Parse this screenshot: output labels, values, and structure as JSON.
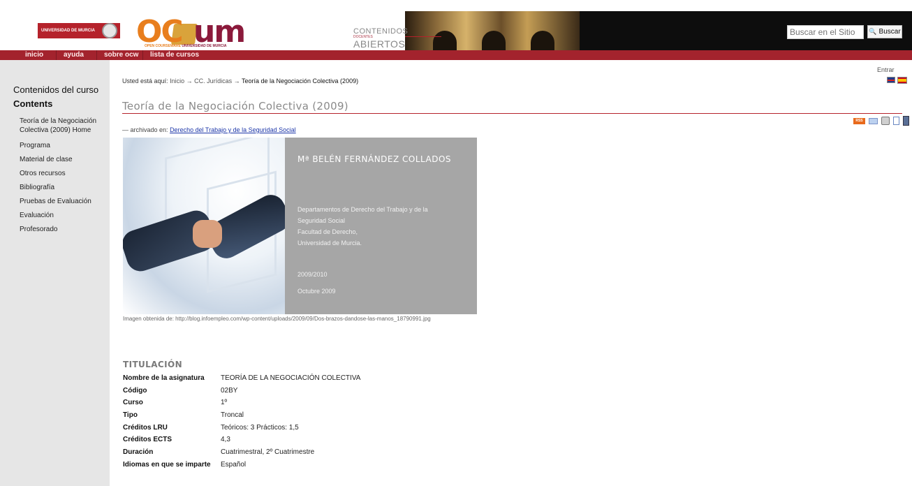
{
  "header": {
    "university_logo_text": "UNIVERSIDAD DE MURCIA",
    "ocw_logo_tagline_a": "OPEN COURSEWARE",
    "ocw_logo_tagline_b": "UNIVERSIDAD DE MURCIA",
    "contenidos_line1": "CONTENIDOS",
    "contenidos_line2": "DOCENTES",
    "contenidos_line3": "ABIERTOS",
    "search_placeholder": "Buscar en el Sitio",
    "search_button_label": "Buscar"
  },
  "nav": {
    "items": [
      "inicio",
      "ayuda",
      "sobre ocw",
      "lista de cursos"
    ]
  },
  "sidebar": {
    "title": "Contenidos del curso",
    "subtitle": "Contents",
    "items": [
      "Teoría de la Negociación Colectiva (2009) Home",
      "Programa",
      "Material de clase",
      "Otros recursos",
      "Bibliografía",
      "Pruebas de Evaluación",
      "Evaluación",
      "Profesorado"
    ]
  },
  "login_label": "Entrar",
  "breadcrumb": {
    "label": "Usted está aquí:",
    "items": [
      "Inicio",
      "CC. Jurídicas",
      "Teoría de la Negociación Colectiva (2009)"
    ],
    "separator": "→"
  },
  "page_title": "Teoría de la Negociación Colectiva (2009)",
  "archived": {
    "prefix": "— archivado en:",
    "link": "Derecho del Trabajo y de la Seguridad Social"
  },
  "doc_actions": {
    "rss_label": "RSS"
  },
  "hero": {
    "name": "Mª BELÉN FERNÁNDEZ COLLADOS",
    "lines": [
      "Departamentos de Derecho del Trabajo y de la",
      "Seguridad Social",
      "Facultad de Derecho,",
      "Universidad de Murcia."
    ],
    "year": "2009/2010",
    "date": "Octubre 2009",
    "caption": "Imagen obtenida de: http://blog.infoempleo.com/wp-content/uploads/2009/09/Dos-brazos-dandose-las-manos_18790991.jpg"
  },
  "titulacion": {
    "heading": "TITULACIÓN",
    "rows": [
      {
        "key": "Nombre de la asignatura",
        "value": "TEORÍA DE LA NEGOCIACIÓN COLECTIVA"
      },
      {
        "key": "Código",
        "value": "02BY"
      },
      {
        "key": "Curso",
        "value": "1º"
      },
      {
        "key": "Tipo",
        "value": "Troncal"
      },
      {
        "key": "Créditos LRU",
        "value": "Teóricos: 3 Prácticos: 1,5"
      },
      {
        "key": "Créditos ECTS",
        "value": "4,3"
      },
      {
        "key": "Duración",
        "value": "Cuatrimestral, 2º Cuatrimestre"
      },
      {
        "key": "Idiomas en que se imparte",
        "value": "Español"
      }
    ]
  }
}
